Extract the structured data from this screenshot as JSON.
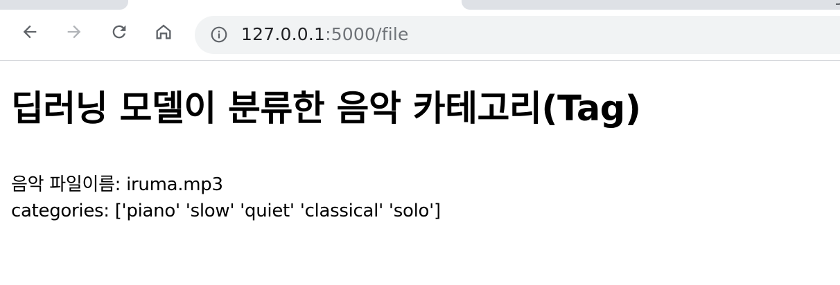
{
  "browser": {
    "url_host": "127.0.0.1",
    "url_path": ":5000/file",
    "icons": {
      "back": "arrow-left-icon",
      "forward": "arrow-right-icon",
      "reload": "reload-icon",
      "home": "home-icon",
      "site_info": "info-circle-icon"
    },
    "colors": {
      "toolbar_bg": "#ffffff",
      "omnibox_bg": "#f1f3f4",
      "tab_bg": "#dee1e6",
      "icon_active": "#5f6368",
      "icon_disabled": "#b1b4b8"
    }
  },
  "page": {
    "title": "딥러닝 모델이 분류한 음악 카테고리(Tag)",
    "file_line": "음악 파일이름: iruma.mp3",
    "categories_line": "categories: ['piano' 'slow' 'quiet' 'classical' 'solo']"
  }
}
